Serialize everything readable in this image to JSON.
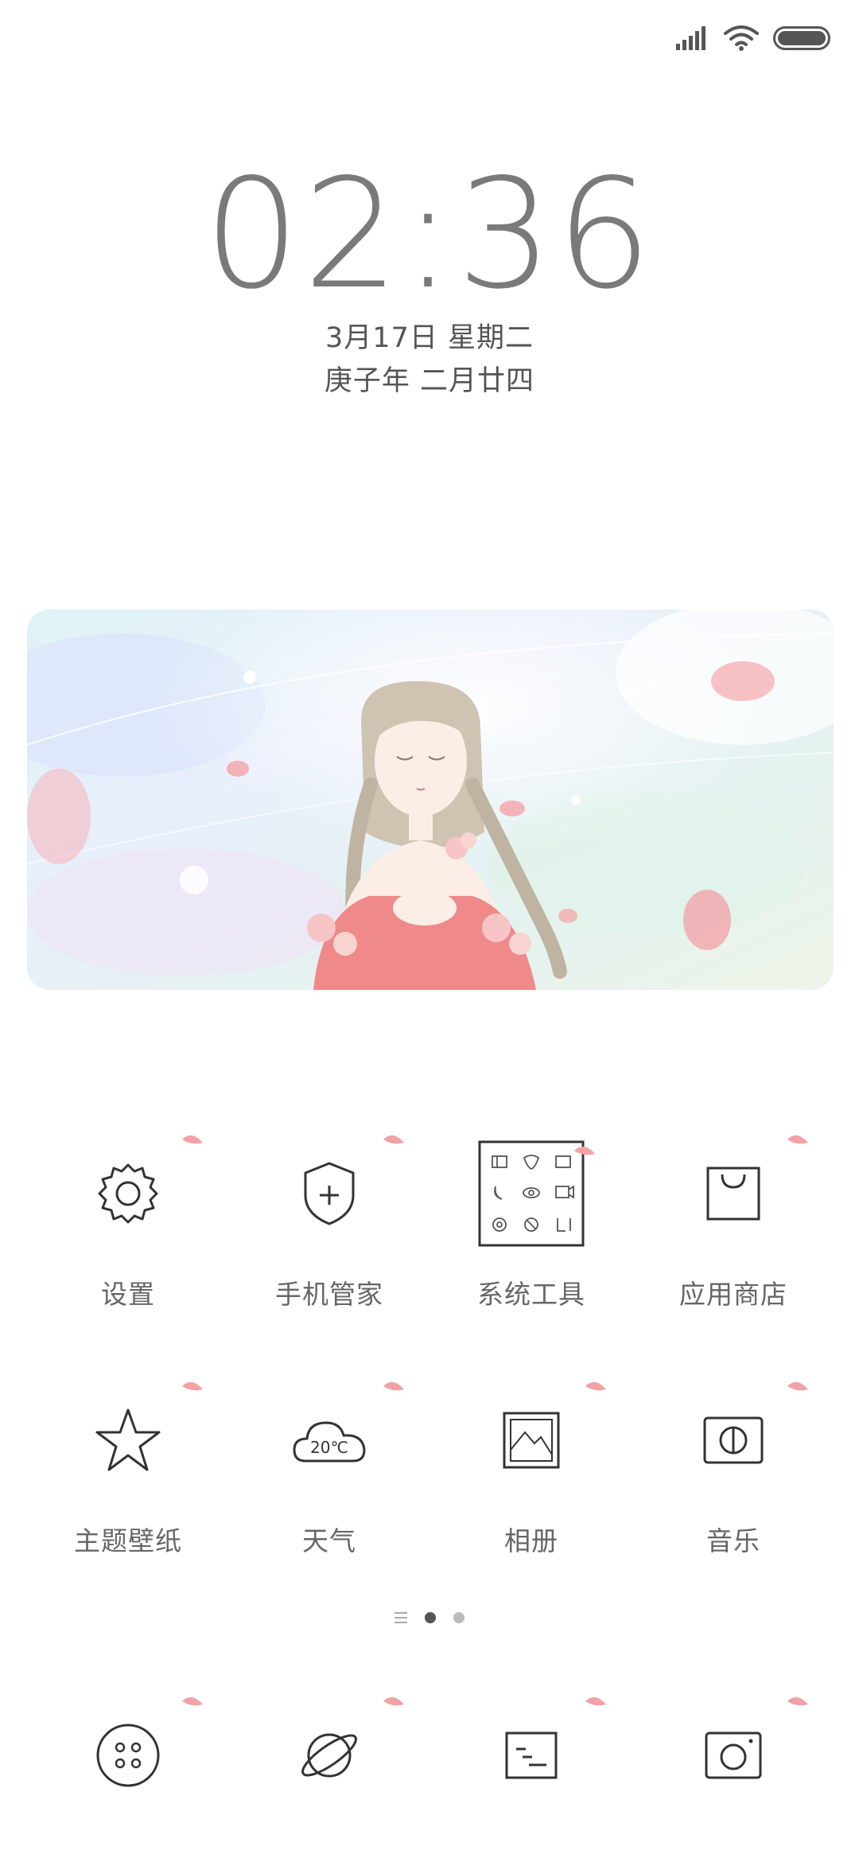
{
  "status_bar": {
    "icons": [
      "signal-icon",
      "wifi-icon",
      "battery-icon"
    ]
  },
  "lockscreen": {
    "time": "02:36",
    "date": "3月17日 星期二",
    "lunar_date": "庚子年 二月廿四"
  },
  "banner": {
    "image": "anime-girl-sakura-illustration"
  },
  "apps": [
    {
      "label": "设置",
      "icon": "gear-icon"
    },
    {
      "label": "手机管家",
      "icon": "shield-plus-icon"
    },
    {
      "label": "系统工具",
      "icon": "tools-folder-icon"
    },
    {
      "label": "应用商店",
      "icon": "shopping-bag-icon"
    },
    {
      "label": "主题壁纸",
      "icon": "star-icon"
    },
    {
      "label": "天气",
      "icon": "cloud-weather-icon",
      "weather_text": "20℃"
    },
    {
      "label": "相册",
      "icon": "photo-icon"
    },
    {
      "label": "音乐",
      "icon": "music-icon"
    }
  ],
  "dock": [
    {
      "icon": "dots-circle-icon"
    },
    {
      "icon": "planet-icon"
    },
    {
      "icon": "notes-icon"
    },
    {
      "icon": "camera-icon"
    }
  ],
  "pager": {
    "pages": 2,
    "active": 1
  },
  "colors": {
    "background": "#ffffff",
    "icon_stroke": "#333333",
    "petal": "#f2a1a5",
    "text": "#555555"
  }
}
